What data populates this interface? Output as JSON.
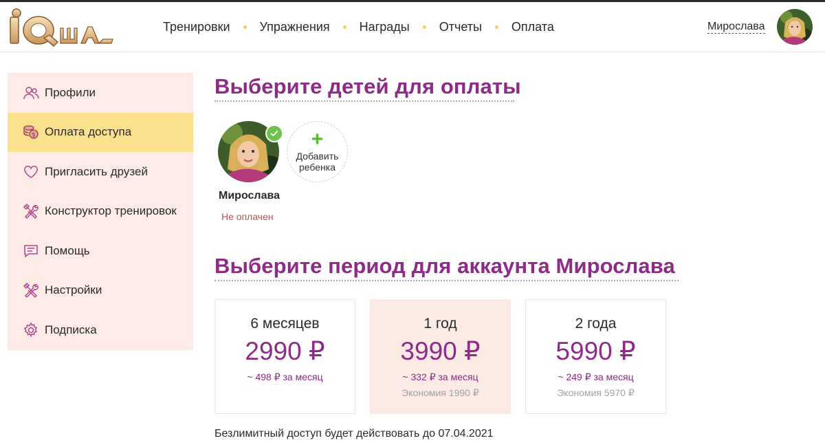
{
  "colors": {
    "accent": "#8e2a87",
    "active_bg": "#fbe18e",
    "sidebar_bg": "#fcebe7",
    "nav_dot": "#f4cf58",
    "status_red": "#c0504a",
    "check_green": "#6cc24a"
  },
  "header": {
    "logo_text": "iQша",
    "nav": [
      {
        "label": "Тренировки"
      },
      {
        "label": "Упражнения"
      },
      {
        "label": "Награды"
      },
      {
        "label": "Отчеты"
      },
      {
        "label": "Оплата"
      }
    ],
    "user_name": "Мирослава"
  },
  "sidebar": {
    "items": [
      {
        "label": "Профили",
        "icon": "users-icon"
      },
      {
        "label": "Оплата доступа",
        "icon": "coins-icon",
        "active": true
      },
      {
        "label": "Пригласить друзей",
        "icon": "heart-icon"
      },
      {
        "label": "Конструктор тренировок",
        "icon": "tools-icon"
      },
      {
        "label": "Помощь",
        "icon": "chat-icon"
      },
      {
        "label": "Настройки",
        "icon": "tools-icon"
      },
      {
        "label": "Подписка",
        "icon": "gear-icon"
      }
    ]
  },
  "main": {
    "children_title": "Выберите детей для оплаты",
    "child": {
      "name": "Мирослава",
      "status": "Не оплачен",
      "selected": true
    },
    "add_child_label_1": "Добавить",
    "add_child_label_2": "ребенка",
    "add_child_plus": "+",
    "period_title": "Выберите период для аккаунта Мирослава",
    "plans": [
      {
        "period": "6 месяцев",
        "price": "2990 ₽",
        "per_month": "~ 498 ₽ за месяц",
        "saving": ""
      },
      {
        "period": "1 год",
        "price": "3990 ₽",
        "per_month": "~ 332 ₽ за месяц",
        "saving": "Экономия 1990 ₽",
        "selected": true
      },
      {
        "period": "2 года",
        "price": "5990 ₽",
        "per_month": "~ 249 ₽ за месяц",
        "saving": "Экономия 5970 ₽"
      }
    ],
    "access_note": "Безлимитный доступ будет действовать до 07.04.2021"
  }
}
